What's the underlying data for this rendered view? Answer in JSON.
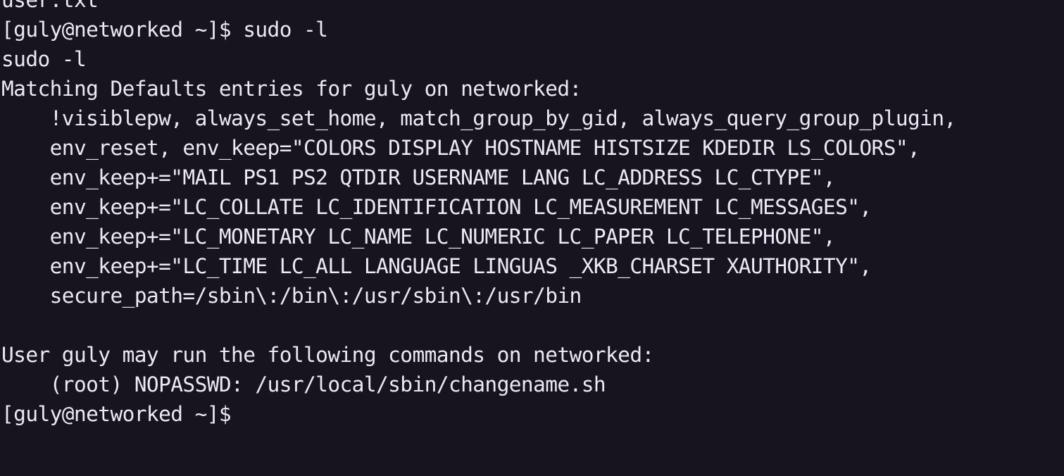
{
  "terminal": {
    "lines": [
      "user.txt",
      "[guly@networked ~]$ sudo -l",
      "sudo -l",
      "Matching Defaults entries for guly on networked:",
      "    !visiblepw, always_set_home, match_group_by_gid, always_query_group_plugin,",
      "    env_reset, env_keep=\"COLORS DISPLAY HOSTNAME HISTSIZE KDEDIR LS_COLORS\",",
      "    env_keep+=\"MAIL PS1 PS2 QTDIR USERNAME LANG LC_ADDRESS LC_CTYPE\",",
      "    env_keep+=\"LC_COLLATE LC_IDENTIFICATION LC_MEASUREMENT LC_MESSAGES\",",
      "    env_keep+=\"LC_MONETARY LC_NAME LC_NUMERIC LC_PAPER LC_TELEPHONE\",",
      "    env_keep+=\"LC_TIME LC_ALL LANGUAGE LINGUAS _XKB_CHARSET XAUTHORITY\",",
      "    secure_path=/sbin\\:/bin\\:/usr/sbin\\:/usr/bin",
      "",
      "User guly may run the following commands on networked:",
      "    (root) NOPASSWD: /usr/local/sbin/changename.sh",
      "[guly@networked ~]$ "
    ]
  },
  "colors": {
    "background": "#171420",
    "foreground": "#ece9f2"
  }
}
